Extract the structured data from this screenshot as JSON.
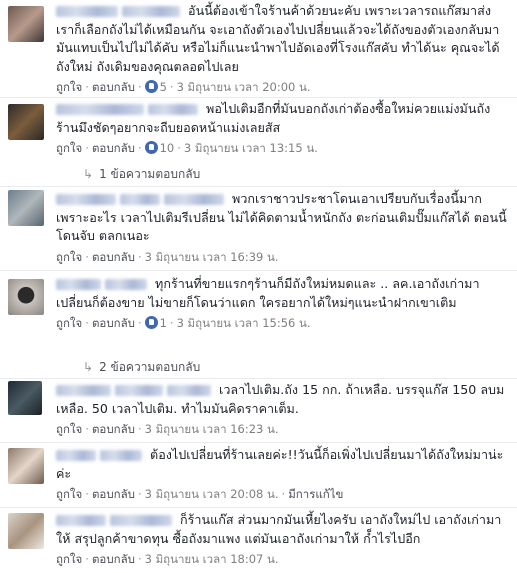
{
  "comments": [
    {
      "text": "อันนี้ต้องเข้าใจร้านค้าด้วยนะคับ เพราะเวลารถแก๊สมาส่งเราก็เลือกถังไม่ได้เหมือนกัน จะเอาถังตัวเองไปเปลี่ยนแล้วจะได้ถังของตัวเองกลับมามันแทบเป็นไปไม่ได้คับ หรือไม่ก็แนะนำพาไปอัดเองที่โรงแก๊สคับ ทำได้นะ คุณจะได้ถังใหม่ ถังเดิมของคุณตลอดไปเลย",
      "like_label": "ถูกใจ",
      "reply_label": "ตอบกลับ",
      "likes": "5",
      "time": "3 มิถุนายน เวลา 20:00 น."
    },
    {
      "text": "พอไปเติมอีกที่มันบอกถังเก่าต้องซื้อใหม่ควยแม่งมันถังร้านมึงชัดๆอยากจะถีบยอดหน้าแม่งเลยสัส",
      "like_label": "ถูกใจ",
      "reply_label": "ตอบกลับ",
      "likes": "10",
      "time": "3 มิถุนายน เวลา 13:15 น.",
      "replies": "1 ข้อความตอบกลับ"
    },
    {
      "text": "พวกเราชาวประชาโดนเอาเปรียบกับเรื่องนี้มากเพราะอะไร เวลาไปเติมรีเปลี่ยน ไม่ได้คิดตามน้ำหนักถัง ตะก่อนเติมปั๊มแก๊สได้ ตอนนี้โดนจับ ตลกเนอะ",
      "like_label": "ถูกใจ",
      "reply_label": "ตอบกลับ",
      "time": "3 มิถุนายน เวลา 16:39 น."
    },
    {
      "text": "ทุกร้านที่ขายแรกๆร้านก็มีถังใหม่หมดและ .. ลค.เอาถังเก่ามาเปลี่ยนก็ต้องขาย ไม่ขายก็โดนว่าแดก ใครอยากได้ใหม่ๆแนะนำฝากเขาเติม",
      "like_label": "ถูกใจ",
      "reply_label": "ตอบกลับ",
      "likes": "1",
      "time": "3 มิถุนายน เวลา 15:56 น.",
      "replies": "2 ข้อความตอบกลับ"
    },
    {
      "text": "เวลาไปเติม.ถัง 15 กก. ถ้าเหลือ. บรรจุแก๊ส 150 ลบม เหลือ. 50 เวลาไปเติม. ทำไมมันคิดราคาเต็ม.",
      "like_label": "ถูกใจ",
      "reply_label": "ตอบกลับ",
      "time": "3 มิถุนายน เวลา 16:23 น."
    },
    {
      "text": "ต้องไปเปลี่ยนที่ร้านเลยค่ะ!!วันนี้ก็อเพิ่งไปเปลี่ยนมาได้ถังใหม่มาน่ะค่ะ",
      "like_label": "ถูกใจ",
      "reply_label": "ตอบกลับ",
      "time": "3 มิถุนายน เวลา 20:08 น.",
      "edited": "มีการแก้ไข"
    },
    {
      "text": "ก็ร้านแก๊ส ส่วนมากมันเหี้ยไงครับ เอาถังใหม่ไป เอาถังเก่ามาให้ สรุปลูกค้าขาดทุน ซื้อถังมาแพง แต่มันเอาถังเก่ามาให้ ก็ำไรไปอีก",
      "like_label": "ถูกใจ",
      "reply_label": "ตอบกลับ",
      "time": "3 มิถุนายน เวลา 18:07 น."
    }
  ]
}
